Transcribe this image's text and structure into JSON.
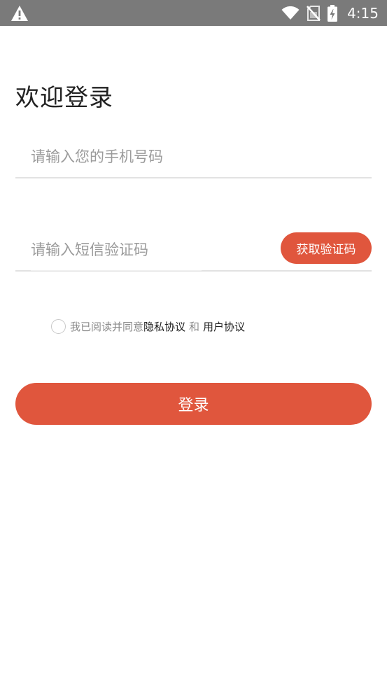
{
  "status_bar": {
    "time": "4:15",
    "icons": [
      "warning-icon",
      "wifi-icon",
      "no-sim-icon",
      "battery-charging-icon"
    ],
    "background": "#7a7a7a"
  },
  "page": {
    "title": "欢迎登录"
  },
  "form": {
    "phone_placeholder": "请输入您的手机号码",
    "phone_value": "",
    "code_placeholder": "请输入短信验证码",
    "code_value": "",
    "get_code_label": "获取验证码"
  },
  "agreement": {
    "checked": false,
    "prefix": "我已阅读并同意",
    "privacy_link": "隐私协议",
    "and_text": "和",
    "user_link": "用户协议"
  },
  "login_button": {
    "label": "登录"
  },
  "colors": {
    "accent": "#e0563d",
    "title_text": "#222222",
    "placeholder": "#9b9b9b",
    "divider": "#e2e2e2"
  }
}
